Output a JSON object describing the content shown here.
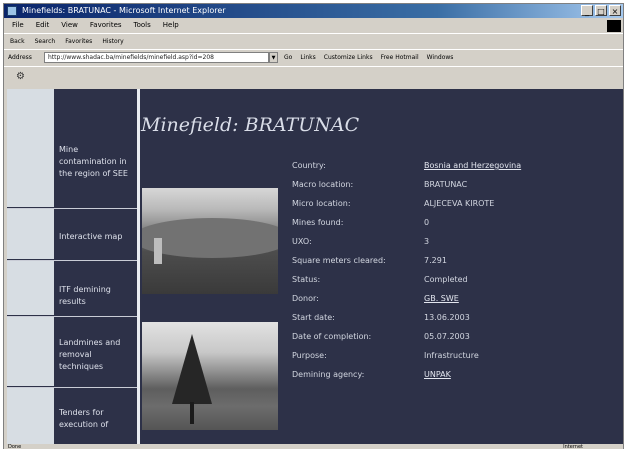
{
  "window": {
    "title": "Minefields: BRATUNAC - Microsoft Internet Explorer"
  },
  "menu": [
    "File",
    "Edit",
    "View",
    "Favorites",
    "Tools",
    "Help"
  ],
  "toolbar": [
    "Back",
    "Search",
    "Favorites",
    "History"
  ],
  "address": {
    "label": "Address",
    "url": "http://www.shadac.ba/minefields/minefield.asp?id=208",
    "links": [
      "Go",
      "Links",
      "Customize Links",
      "Free Hotmail",
      "Windows"
    ]
  },
  "nav": {
    "items": [
      "Mine contamination in the region of SEE",
      "Interactive map",
      "ITF demining results",
      "Landmines and removal techniques",
      "Tenders for execution of"
    ]
  },
  "page": {
    "title": "Minefield: BRATUNAC"
  },
  "details": [
    {
      "label": "Country:",
      "value": "Bosnia and Herzegovina",
      "link": true
    },
    {
      "label": "Macro location:",
      "value": "BRATUNAC"
    },
    {
      "label": "Micro location:",
      "value": "ALJECEVA KIROTE"
    },
    {
      "label": "Mines found:",
      "value": "0"
    },
    {
      "label": "UXO:",
      "value": "3"
    },
    {
      "label": "Square meters cleared:",
      "value": "7.291"
    },
    {
      "label": "Status:",
      "value": "Completed"
    },
    {
      "label": "Donor:",
      "value": "GB. SWE",
      "link": true
    },
    {
      "label": "Start date:",
      "value": "13.06.2003"
    },
    {
      "label": "Date of completion:",
      "value": "05.07.2003"
    },
    {
      "label": "Purpose:",
      "value": "Infrastructure"
    },
    {
      "label": "Demining agency:",
      "value": "UNPAK",
      "link": true
    }
  ],
  "status": {
    "left": "Done",
    "right": "Internet"
  },
  "colors": {
    "page_bg": "#2d3148",
    "gutter": "#d7dde3",
    "text": "#d2d6e0"
  }
}
